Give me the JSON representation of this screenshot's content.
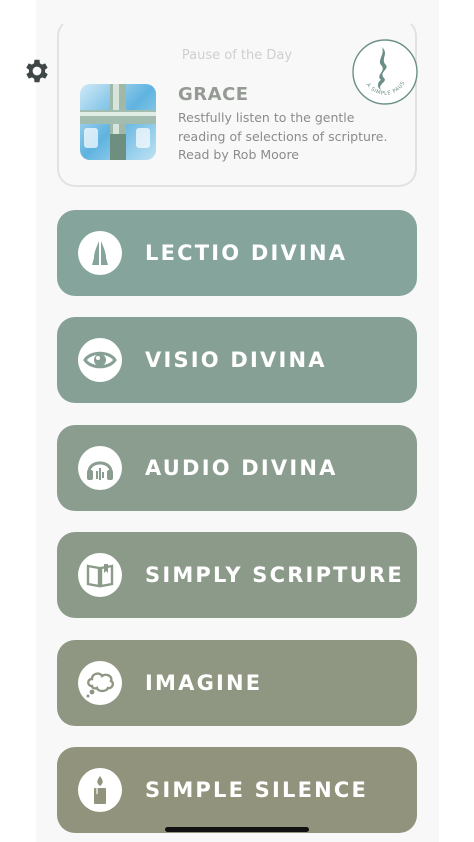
{
  "pause_of_day": {
    "section_title": "Pause of the Day",
    "heading": "GRACE",
    "description": "Restfully listen to the gentle reading of selections of scripture.",
    "reader": "Read by Rob Moore",
    "logo_text": "A SIMPLE PAUSE"
  },
  "menu": [
    {
      "label": "LECTIO DIVINA",
      "icon": "praying-hands-icon",
      "color": "#85a49c"
    },
    {
      "label": "VISIO DIVINA",
      "icon": "eye-icon",
      "color": "#87a095"
    },
    {
      "label": "AUDIO DIVINA",
      "icon": "headphones-icon",
      "color": "#8a9d8f"
    },
    {
      "label": "SIMPLY SCRIPTURE",
      "icon": "open-book-icon",
      "color": "#8c9a8a"
    },
    {
      "label": "IMAGINE",
      "icon": "thought-cloud-icon",
      "color": "#8f9782"
    },
    {
      "label": "SIMPLE SILENCE",
      "icon": "candle-icon",
      "color": "#91937c"
    }
  ],
  "colors": {
    "card_text": "#959a94",
    "logo_teal": "#6b8f88"
  }
}
